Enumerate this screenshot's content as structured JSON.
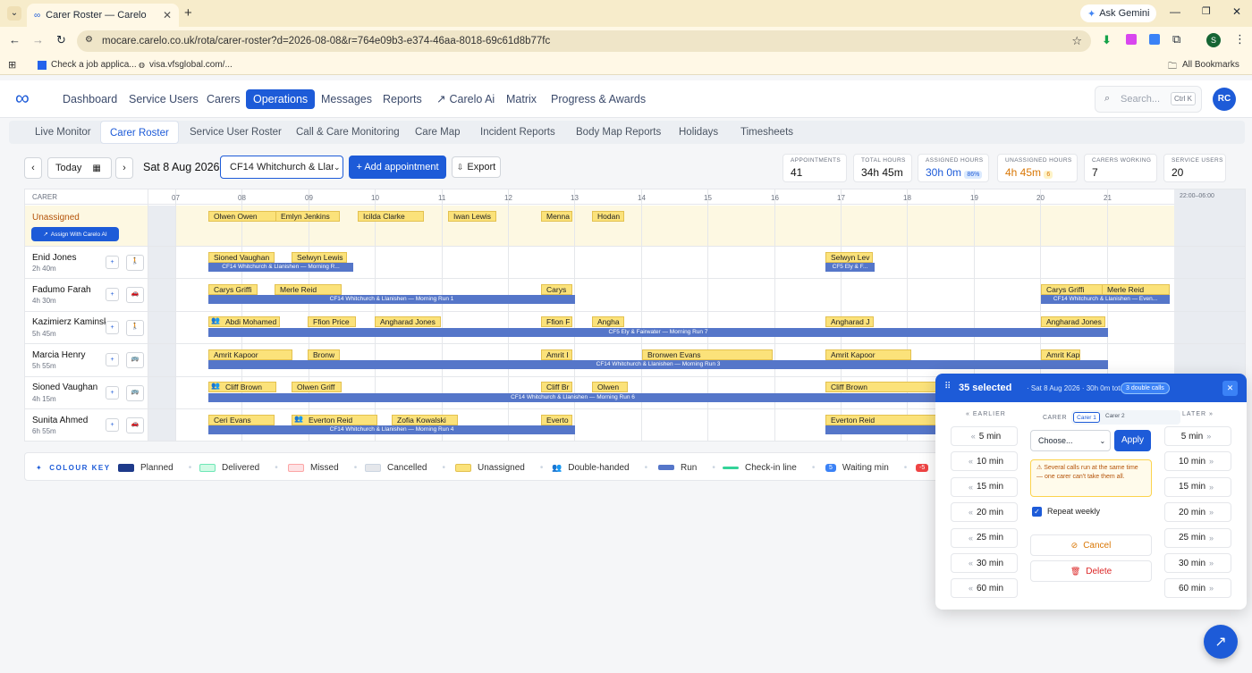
{
  "browser": {
    "tab_title": "Carer Roster — Carelo",
    "url": "mocare.carelo.co.uk/rota/carer-roster?d=2026-08-08&r=764e09b3-e374-46aa-8018-69c61d8b77fc",
    "ask_gemini": "Ask Gemini",
    "profile": "S",
    "bookmarks": [
      "Check a job applica...",
      "visa.vfsglobal.com/..."
    ],
    "all_bookmarks": "All Bookmarks"
  },
  "nav": {
    "items": [
      "Dashboard",
      "Service Users",
      "Carers",
      "Operations",
      "Messages",
      "Reports",
      "Carelo Ai",
      "Matrix",
      "Progress & Awards"
    ],
    "active": "Operations",
    "search_placeholder": "Search...",
    "search_shortcut": "Ctrl K",
    "avatar": "RC"
  },
  "subnav": {
    "items": [
      "Live Monitor",
      "Carer Roster",
      "Service User Roster",
      "Call & Care Monitoring",
      "Care Map",
      "Incident Reports",
      "Body Map Reports",
      "Holidays",
      "Timesheets"
    ],
    "active": "Carer Roster"
  },
  "toolbar": {
    "prev": "‹",
    "today": "Today",
    "next": "›",
    "date": "Sat 8 Aug 2026",
    "area_select": "CF14 Whitchurch & Llanishen",
    "add_button": "+ Add appointment",
    "export_button": "Export"
  },
  "stats": [
    {
      "label": "APPOINTMENTS",
      "value": "41",
      "badge": ""
    },
    {
      "label": "TOTAL HOURS",
      "value": "34h 45m",
      "badge": ""
    },
    {
      "label": "ASSIGNED HOURS",
      "value": "30h 0m",
      "badge": "86%"
    },
    {
      "label": "UNASSIGNED HOURS",
      "value": "4h 45m",
      "badge": "6"
    },
    {
      "label": "CARERS WORKING",
      "value": "7",
      "badge": ""
    },
    {
      "label": "SERVICE USERS",
      "value": "20",
      "badge": ""
    }
  ],
  "grid": {
    "carer_header": "CARER",
    "hours": [
      "07",
      "08",
      "09",
      "10",
      "11",
      "12",
      "13",
      "14",
      "15",
      "16",
      "17",
      "18",
      "19",
      "20",
      "21"
    ],
    "night_label": "22:00–06:00",
    "unassigned_label": "Unassigned",
    "assign_ai_button": "Assign With Carelo AI",
    "unassigned_appts": [
      "Olwen Owen",
      "Emlyn Jenkins",
      "Icilda Clarke",
      "Iwan Lewis",
      "Menna",
      "Hodan"
    ],
    "carers": [
      {
        "name": "Enid Jones",
        "hours": "2h 40m",
        "appts": [
          "Sioned Vaughan",
          "Selwyn Lewis",
          "Selwyn Lev"
        ],
        "runs": [
          "CF14 Whitchurch & Llanishen — Morning R...",
          "CF5 Ely & F..."
        ]
      },
      {
        "name": "Fadumo Farah",
        "hours": "4h 30m",
        "appts": [
          "Carys Griffi",
          "Merle Reid",
          "Carys",
          "Carys Griffi",
          "Merle Reid"
        ],
        "runs": [
          "CF14 Whitchurch & Llanishen — Morning Run 1",
          "CF14 Whitchurch & Llanishen — Even..."
        ]
      },
      {
        "name": "Kazimierz Kaminska",
        "hours": "5h 45m",
        "appts": [
          "Abdi Mohamed",
          "Ffion Price",
          "Angharad Jones",
          "Ffion F",
          "Angha",
          "Angharad J",
          "Angharad Jones"
        ],
        "runs": [
          "CF5 Ely & Fairwater — Morning Run 7"
        ]
      },
      {
        "name": "Marcia Henry",
        "hours": "5h 55m",
        "appts": [
          "Amrit Kapoor",
          "Bronw",
          "Amrit I",
          "Bronwen Evans",
          "Amrit Kapoor",
          "Amrit Kap"
        ],
        "runs": [
          "CF14 Whitchurch & Llanishen — Morning Run 3"
        ]
      },
      {
        "name": "Sioned Vaughan",
        "hours": "4h 15m",
        "appts": [
          "Cliff Brown",
          "Olwen Griff",
          "Cliff Br",
          "Olwen",
          "Cliff Brown"
        ],
        "runs": [
          "CF14 Whitchurch & Llanishen — Morning Run 6"
        ]
      },
      {
        "name": "Sunita Ahmed",
        "hours": "6h 55m",
        "appts": [
          "Ceri Evans",
          "Everton Reid",
          "Zofia Kowalski",
          "Everto",
          "Everton Reid"
        ],
        "runs": [
          "CF14 Whitchurch & Llanishen — Morning Run 4"
        ]
      }
    ]
  },
  "colour_key": {
    "title": "COLOUR KEY",
    "items": [
      {
        "label": "Planned",
        "color": "#1e3a8a"
      },
      {
        "label": "Delivered",
        "color": "#d1fae5"
      },
      {
        "label": "Missed",
        "color": "#fde2e4"
      },
      {
        "label": "Cancelled",
        "color": "#e5e7eb"
      },
      {
        "label": "Unassigned",
        "color": "#fbe27a"
      },
      {
        "label": "Double-handed",
        "color": ""
      },
      {
        "label": "Run",
        "color": "#5576c9"
      },
      {
        "label": "Check-in line",
        "color": "#34d399"
      },
      {
        "label": "Waiting min",
        "color": "#3b82f6",
        "badge": "5"
      },
      {
        "label": "",
        "color": "#ef4444",
        "badge": "-5"
      }
    ]
  },
  "popup": {
    "selected": "35 selected",
    "summary": "· Sat 8 Aug 2026 · 30h 0m total",
    "double_badge": "3 double calls",
    "earlier_label": "EARLIER",
    "later_label": "LATER",
    "carer_label": "CARER",
    "carer_tabs": [
      "Carer 1",
      "Carer 2"
    ],
    "choose_placeholder": "Choose...",
    "apply": "Apply",
    "warning": "Several calls run at the same time — one carer can't take them all.",
    "repeat_weekly": "Repeat weekly",
    "cancel": "Cancel",
    "delete": "Delete",
    "shifts": [
      "5 min",
      "10 min",
      "15 min",
      "20 min",
      "25 min",
      "30 min",
      "60 min"
    ]
  }
}
